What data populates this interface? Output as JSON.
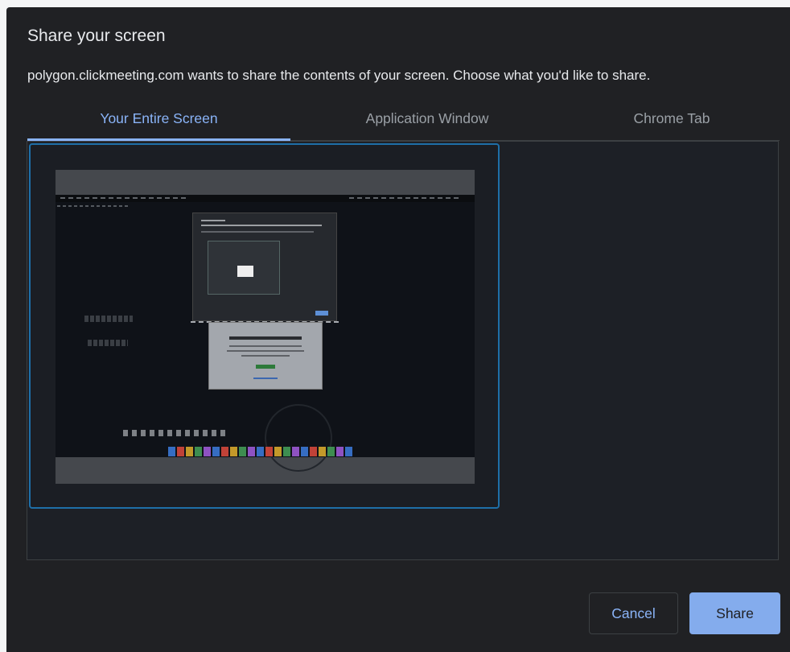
{
  "dialog": {
    "title": "Share your screen",
    "subtitle": "polygon.clickmeeting.com wants to share the contents of your screen. Choose what you'd like to share.",
    "tabs": [
      {
        "label": "Your Entire Screen",
        "active": true
      },
      {
        "label": "Application Window",
        "active": false
      },
      {
        "label": "Chrome Tab",
        "active": false
      }
    ],
    "buttons": {
      "cancel_label": "Cancel",
      "share_label": "Share"
    }
  },
  "colors": {
    "background": "#202124",
    "accent": "#8ab4f8",
    "selected_border": "#1e6fa8",
    "text": "#e8eaed",
    "muted_text": "#9aa0a6"
  }
}
